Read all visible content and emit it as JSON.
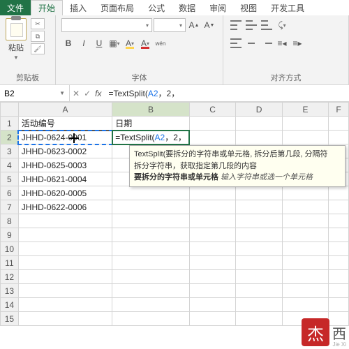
{
  "tabs": {
    "file": "文件",
    "home": "开始",
    "insert": "插入",
    "layout": "页面布局",
    "formulas": "公式",
    "data": "数据",
    "review": "审阅",
    "view": "视图",
    "dev": "开发工具"
  },
  "ribbon": {
    "paste": "粘贴",
    "clipboard": "剪贴板",
    "font_group": "字体",
    "align_group": "对齐方式",
    "bold": "B",
    "italic": "I",
    "underline": "U"
  },
  "namebox": "B2",
  "formula_prefix": "=TextSplit(",
  "formula_arg_ref": "A2",
  "formula_suffix": "，2，",
  "columns": [
    "A",
    "B",
    "C",
    "D",
    "E",
    "F"
  ],
  "rows": [
    "1",
    "2",
    "3",
    "4",
    "5",
    "6",
    "7",
    "8",
    "9",
    "10",
    "11",
    "12",
    "13",
    "14",
    "15"
  ],
  "header": {
    "A": "活动编号",
    "B": "日期"
  },
  "data_A": {
    "2": "JHHD-0624-0001",
    "3": "JHHD-0623-0002",
    "4": "JHHD-0625-0003",
    "5": "JHHD-0621-0004",
    "6": "JHHD-0620-0005",
    "7": "JHHD-0622-0006"
  },
  "editing_cell": "=TextSplit(A2，2，",
  "tooltip": {
    "sig": "TextSplit(要拆分的字符串或单元格, 拆分后第几段, 分隔符",
    "desc": "拆分字符串，获取指定第几段的内容",
    "arg_label": "要拆分的字符串或单元格",
    "arg_hint": " 输入字符串或选一个单元格"
  },
  "watermark": {
    "char": "杰",
    "text": "西",
    "sub": "Jie Xi"
  }
}
